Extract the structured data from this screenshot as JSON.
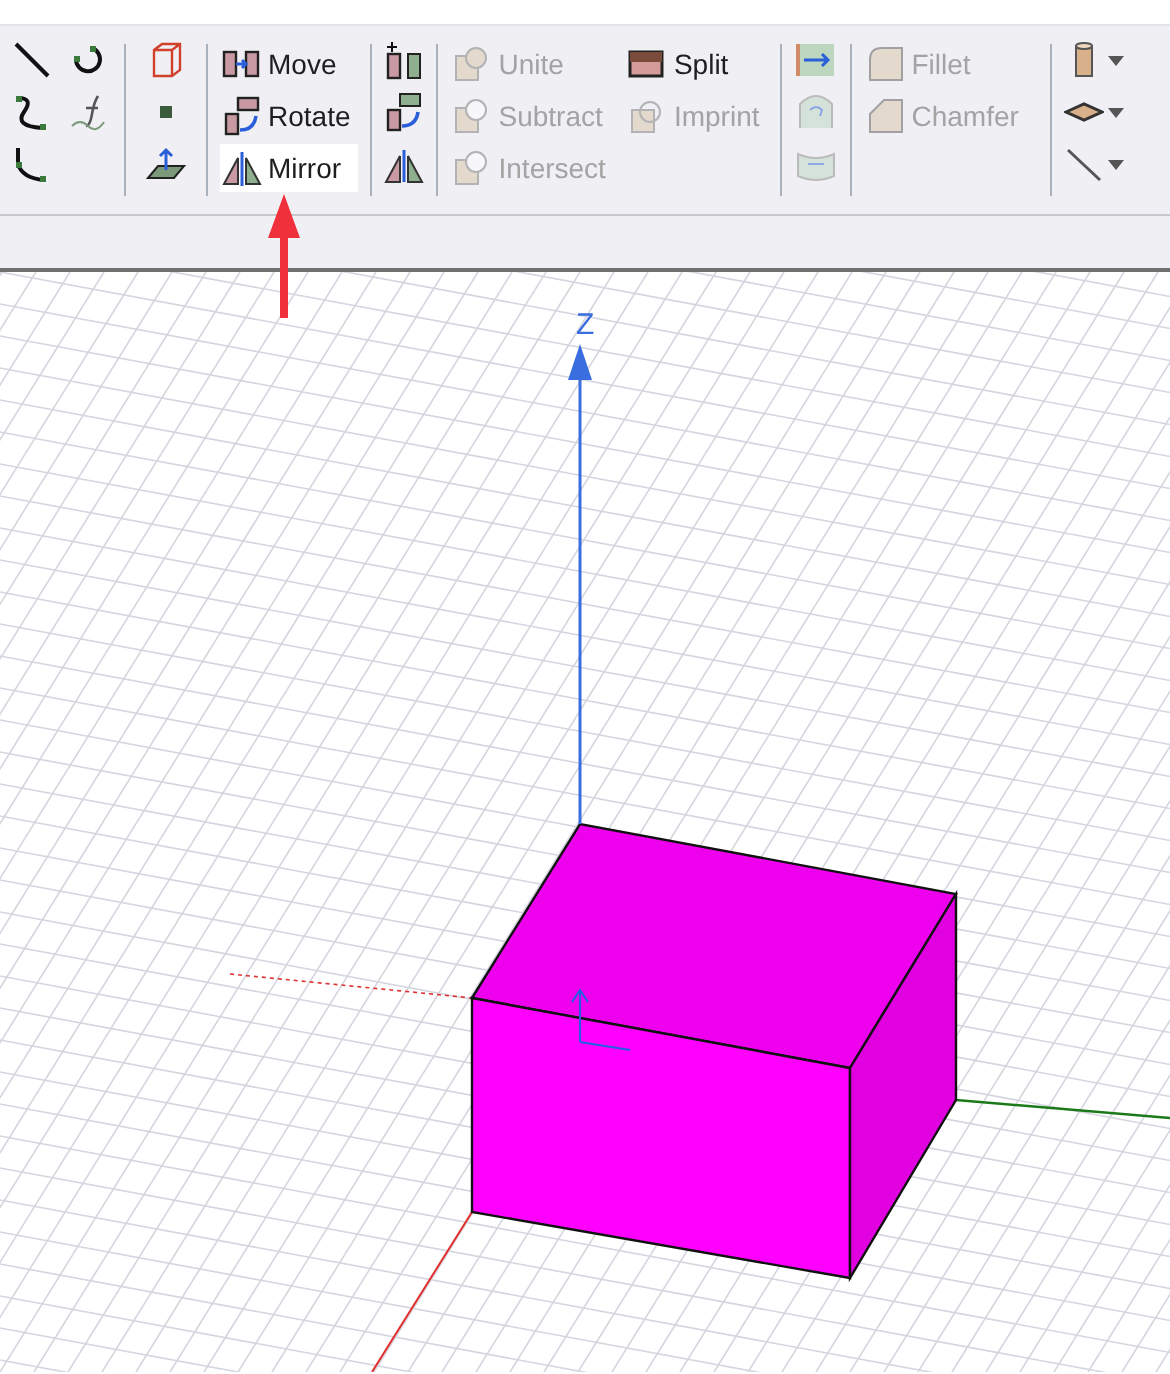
{
  "toolbar": {
    "transform_buttons": [
      {
        "label": "Move",
        "selected": false
      },
      {
        "label": "Rotate",
        "selected": false
      },
      {
        "label": "Mirror",
        "selected": true
      }
    ],
    "boolean_buttons": [
      {
        "label": "Unite",
        "disabled": true
      },
      {
        "label": "Subtract",
        "disabled": true
      },
      {
        "label": "Intersect",
        "disabled": true
      }
    ],
    "split_buttons": [
      {
        "label": "Split",
        "disabled": false
      },
      {
        "label": "Imprint",
        "disabled": true
      }
    ],
    "edge_buttons": [
      {
        "label": "Fillet",
        "disabled": true
      },
      {
        "label": "Chamfer",
        "disabled": true
      }
    ]
  },
  "viewport": {
    "axis_label": "Z"
  }
}
